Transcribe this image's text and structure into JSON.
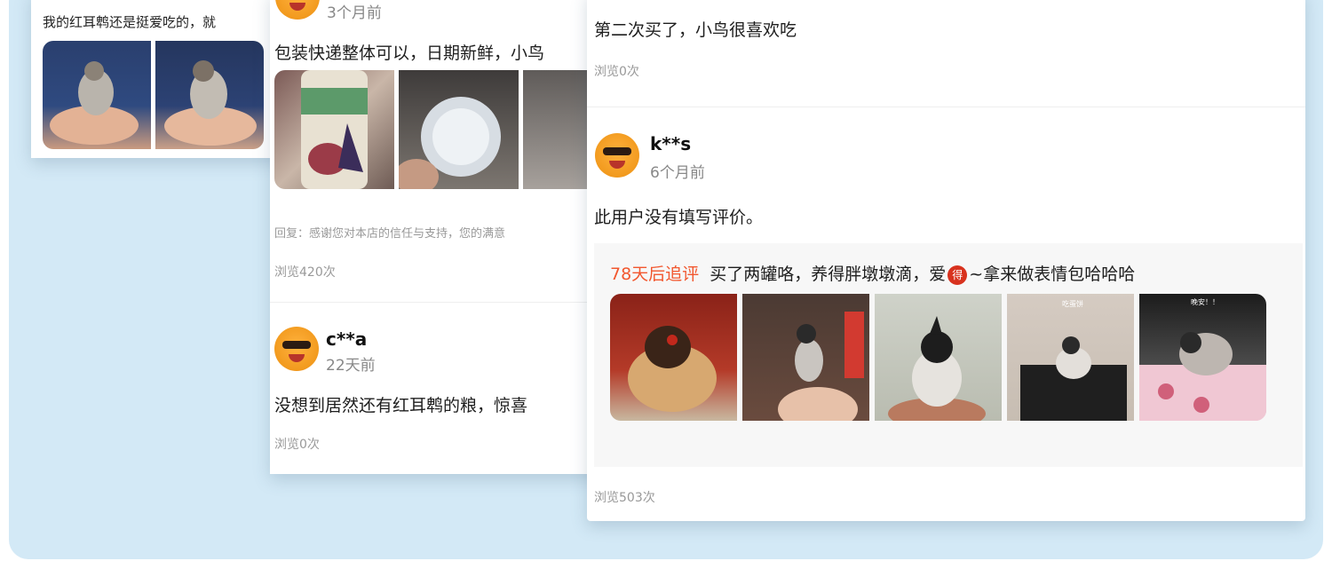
{
  "card_left": {
    "text": "我的红耳鹎还是挺爱吃的，就"
  },
  "card_mid": {
    "review1": {
      "time": "3个月前",
      "text": "包装快递整体可以，日期新鲜，小鸟",
      "reply": "回复：感谢您对本店的信任与支持，您的满意",
      "views": "浏览420次"
    },
    "review2": {
      "user": "c**a",
      "time": "22天前",
      "text": "没想到居然还有红耳鹎的粮，惊喜",
      "views": "浏览0次"
    }
  },
  "card_right": {
    "review1": {
      "text": "第二次买了，小鸟很喜欢吃",
      "views": "浏览0次"
    },
    "review2": {
      "user": "k**s",
      "time": "6个月前",
      "text": "此用户没有填写评价。",
      "followup_label": "78天后追评",
      "followup_text_before": "买了两罐咯，养得胖墩墩滴，爱",
      "followup_badge": "得",
      "followup_text_after": "~拿来做表情包哈哈哈",
      "photo_caption_4": "吃蛋饼",
      "photo_caption_5": "晚安！！",
      "views": "浏览503次"
    }
  },
  "colors": {
    "background_panel": "#d3e9f6",
    "followup_accent": "#f2572e",
    "avatar": "#f29a1e"
  }
}
